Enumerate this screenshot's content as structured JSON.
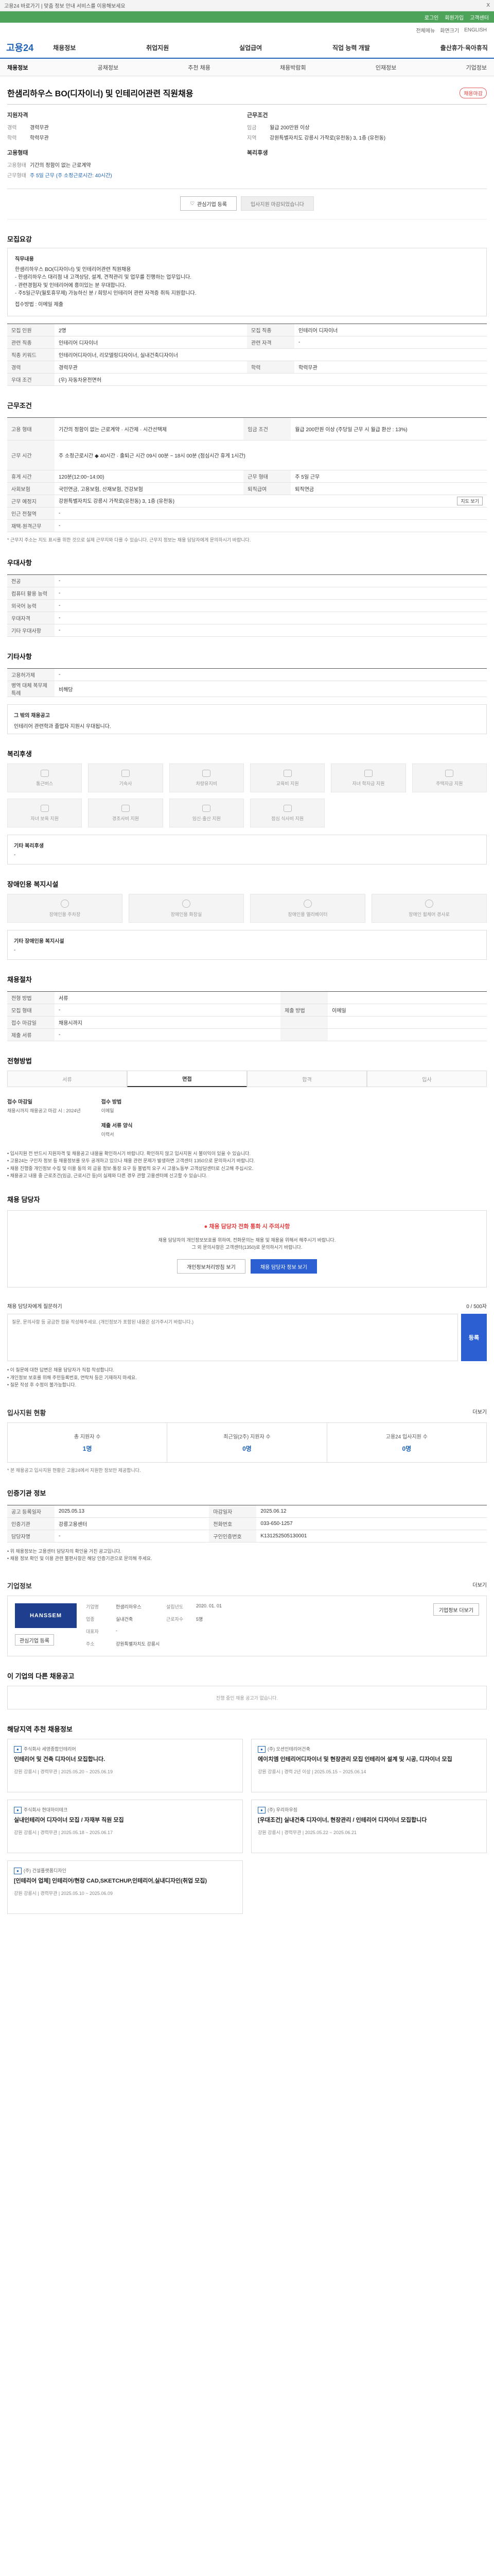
{
  "topbar": {
    "left": "고용24 바로가기 | 맞춤 정보 안내 서비스를 이용해보세요",
    "right": "X"
  },
  "greenbar": {
    "items": [
      "로그인",
      "회원가입",
      "고객센터"
    ]
  },
  "logo_row": {
    "items": [
      "전체메뉴",
      "화면크기",
      "ENGLISH"
    ]
  },
  "gnb": {
    "logo": "고용24",
    "menu": [
      "채용정보",
      "취업지원",
      "실업급여",
      "직업 능력 개발",
      "출산휴가·육아휴직"
    ]
  },
  "subnav": [
    "채용정보",
    "공채정보",
    "추천 채용",
    "채용박람회",
    "인재정보",
    "기업정보"
  ],
  "job": {
    "title": "한샘리하우스 BO(디자이너) 및 인테리어관련 직원채용",
    "status_badge": "채용마감",
    "summary_left_title": "지원자격",
    "summary_left": [
      {
        "k": "경력",
        "v": "경력무관"
      },
      {
        "k": "학력",
        "v": "학력무관"
      }
    ],
    "summary_left2_title": "고용형태",
    "summary_left2": [
      {
        "k": "고용형태",
        "v": "기간의 정함이 없는 근로계약"
      },
      {
        "k": "근무형태",
        "v": "주 5일 근무 (주 소정근로시간: 40시간)"
      }
    ],
    "summary_right_title": "근무조건",
    "summary_right": [
      {
        "k": "임금",
        "v": "월급 200만원 이상"
      },
      {
        "k": "지역",
        "v": "강원특별자치도 강릉시 가작로(유천동) 3, 1층 (유천동)"
      }
    ],
    "summary_right2_title": "복리후생",
    "buttons": {
      "interest": "관심기업 등록",
      "apply": "입사지원 마감되었습니다"
    }
  },
  "recruit_section": {
    "title": "모집요강",
    "description": [
      "직무내용",
      "한샘리하우스 BO(디자이너) 및 인테리어관련 직원채용",
      "- 한샘리하우스 대리점 내 고객상담, 설계, 견적관리 및 업무를 진행하는 업무입니다.",
      "- 관련경험자 및 인테리어에 흥미있는 분 우대합니다.",
      "- 주5일근무(월토휴무제) 가능하신 분 / 희망시 인테리어 관련 자격증 취득 지원합니다.",
      "접수방법 : 이메일 제출"
    ],
    "rows": [
      [
        {
          "th": "모집 인원",
          "td": "2명"
        },
        {
          "th": "모집 직종",
          "td": "인테리어 디자이너"
        }
      ],
      [
        {
          "th": "관련 직종",
          "td": "인테리어 디자이너"
        },
        {
          "th": "관련 자격",
          "td": "-"
        }
      ],
      [
        {
          "th": "직종 키워드",
          "td": "인테리어디자이너, 리모델링디자이너, 실내건축디자이너"
        },
        {
          "th": "",
          "td": ""
        }
      ],
      [
        {
          "th": "경력",
          "td": "경력무관"
        },
        {
          "th": "학력",
          "td": "학력무관"
        }
      ],
      [
        {
          "th": "우대 조건",
          "td": "(우) 자동차운전면허"
        },
        {
          "th": "",
          "td": ""
        }
      ]
    ]
  },
  "conditions_section": {
    "title": "근무조건",
    "rows": [
      {
        "th": "고용 형태",
        "td": "기간의 정함이 없는 근로계약 · 시간제 · 시간선택제",
        "th2": "임금 조건",
        "td2": "월급 200만원 이상 (주당일 근무 시 월급 환산 : 13%)"
      },
      {
        "th": "근무 시간",
        "td": "주 소정근로시간 ◆ 40시간 · 출퇴근 시간 09시 00분 ~ 18시 00분 (점심시간 휴게 1시간)",
        "th2": "",
        "td2": ""
      },
      {
        "th": "휴게 시간",
        "td": "120분(12:00~14:00)",
        "th2": "근무 형태",
        "td2": "주 5일 근무"
      },
      {
        "th": "사회보험",
        "td": "국민연금, 고용보험, 산재보험, 건강보험",
        "th2": "퇴직급여",
        "td2": "퇴직연금"
      },
      {
        "th": "근무 예정지",
        "td": "강원특별자치도 강릉시 가작로(유천동) 3, 1층 (유천동)",
        "th2": "",
        "td2": ""
      },
      {
        "th": "인근 전철역",
        "td": "-",
        "th2": "",
        "td2": ""
      },
      {
        "th": "재택·원격근무",
        "td": "-",
        "th2": "",
        "td2": ""
      }
    ],
    "map_button": "지도 보기",
    "note": "* 근무지 주소는 지도 표시를 위한 것으로 실제 근무지와 다를 수 있습니다. 근무지 정보는 채용 담당자에게 문의하시기 바랍니다."
  },
  "preference_section": {
    "title": "우대사항",
    "rows": [
      {
        "th": "전공",
        "td": "-"
      },
      {
        "th": "컴퓨터 활용 능력",
        "td": "-"
      },
      {
        "th": "외국어 능력",
        "td": "-"
      },
      {
        "th": "우대자격",
        "td": "-"
      },
      {
        "th": "기타 우대사항",
        "td": "-"
      }
    ]
  },
  "etc_section": {
    "title": "기타사항",
    "rows": [
      {
        "th": "고용허가제",
        "td": "-"
      },
      {
        "th": "병역 대체 복무제 특례",
        "td": "비해당"
      }
    ],
    "extra_title": "그 밖의 채용공고",
    "extra_text": "인테리어 관련학과 졸업자 지원시 우대됩니다."
  },
  "benefit_section": {
    "title": "복리후생",
    "cards": [
      "통근버스",
      "기숙사",
      "차량유지비",
      "교육비 지원",
      "자녀 학자금 지원",
      "주택자금 지원",
      "자녀 보육 지원",
      "경조사비 지원",
      "임신·출산 지원",
      "점심 식사비 지원"
    ],
    "extra_title": "기타 복리후생",
    "extra_text": "-"
  },
  "welfare_section": {
    "title": "장애인용 복지시설",
    "cards": [
      "장애인용 주차장",
      "장애인용 화장실",
      "장애인용 엘리베이터",
      "장애인 휠체어 경사로"
    ],
    "extra_title": "기타 장애인용 복지시설",
    "extra_text": "-"
  },
  "process_section": {
    "title": "채용절차",
    "rows": [
      {
        "th": "전형 방법",
        "td": "서류",
        "th2": "",
        "td2": ""
      },
      {
        "th": "모집 형태",
        "td": "-",
        "th2": "제출 방법",
        "td2": "이메일"
      },
      {
        "th": "접수 마감일",
        "td": "채용시까지",
        "th2": "",
        "td2": ""
      },
      {
        "th": "제출 서류",
        "td": "-",
        "th2": "",
        "td2": ""
      }
    ]
  },
  "hiring_section": {
    "title": "전형방법",
    "tabs": [
      "서류",
      "면접",
      "합격",
      "입사"
    ],
    "active_tab": 1,
    "blocks": [
      {
        "h": "접수 마감일",
        "p": "채용시까지 채용공고 마감 시 : 2024년"
      },
      {
        "h": "접수 방법",
        "p": "이메일"
      },
      {
        "h": "제출 서류 양식",
        "p": "이력서"
      }
    ],
    "notes": [
      "• 입사지원 전 반드시 지원자격 및 채용공고 내용을 확인하시기 바랍니다. 확인하지 않고 입사지원 시 불이익이 있을 수 있습니다.",
      "• 고용24는 구인자 정보 등 채용정보를 모두 공개하고 있으나 채용 관련 문제가 발생하면 고객센터 1350으로 문의하시기 바랍니다.",
      "• 채용 진행중 개인정보 수집 및 이용 동의 외 금융 정보·통장 요구 등 불법적 요구 시 고용노동부 고객상담센터로 신고해 주십시오.",
      "• 채용공고 내용 중 근로조건(임금, 근로시간 등)이 실제와 다른 경우 관할 고용센터에 신고할 수 있습니다."
    ]
  },
  "contact_section": {
    "title": "채용 담당자",
    "warning": "채용 담당자 전화 통화 시 주의사항",
    "lines": [
      "채용 담당자의 개인정보보호를 위하여, 전화문의는 채용 및 채용을 위해서 해주시기 바랍니다.",
      "그 외 문의사항은 고객센터(1350)로 문의하시기 바랍니다."
    ],
    "btn_view": "채용 담당자 정보 보기",
    "btn_save": "개인정보처리방침 보기"
  },
  "qa_section": {
    "title": "채용 담당자에게 질문하기",
    "counter": "0 / 500자",
    "placeholder": "질문, 문의사항 등 궁금한 점을 작성해주세요. (개인정보가 포함된 내용은 삼가주시기 바랍니다.)",
    "submit": "등록",
    "notes": [
      "• 이 질문에 대한 답변은 채용 담당자가 직접 작성합니다.",
      "• 개인정보 보호를 위해 주민등록번호, 연락처 등은 기재하지 마세요.",
      "• 질문 작성 후 수정이 불가능합니다."
    ]
  },
  "apply_status": {
    "title": "입사지원 현황",
    "link": "더보기",
    "stats": [
      {
        "label": "총 지원자 수",
        "value": "1명"
      },
      {
        "label": "최근일(2주) 지원자 수",
        "value": "0명"
      },
      {
        "label": "고용24 입사지원 수",
        "value": "0명"
      }
    ],
    "note": "* 본 채용공고 입사지원 현황은 고용24에서 지원한 정보만 제공합니다."
  },
  "register_info": {
    "title": "인증기관 정보",
    "rows": [
      {
        "th": "공고 등록일자",
        "td": "2025.05.13",
        "th2": "마감일자",
        "td2": "2025.06.12"
      },
      {
        "th": "인증기관",
        "td": "강릉고용센터",
        "th2": "전화번호",
        "td2": "033-650-1257"
      },
      {
        "th": "담당자명",
        "td": "-",
        "th2": "구인인증번호",
        "td2": "K131252505130001"
      }
    ],
    "notes": [
      "• 위 채용정보는 고용센터 담당자의 확인을 거친 공고입니다.",
      "• 채용 정보 확인 및 이용 관련 불편사항은 해당 인증기관으로 문의해 주세요."
    ]
  },
  "company_section": {
    "title": "기업정보",
    "link": "더보기",
    "logo_text": "HANSSEM",
    "info": [
      {
        "l": "기업명",
        "v": "한샘리하우스",
        "l2": "설립년도",
        "v2": "2020. 01. 01"
      },
      {
        "l": "업종",
        "v": "실내건축",
        "l2": "근로자수",
        "v2": "5명"
      },
      {
        "l": "대표자",
        "v": "-",
        "l2": "",
        "v2": ""
      },
      {
        "l": "주소",
        "v": "강원특별자치도 강릉시",
        "l2": "",
        "v2": ""
      }
    ],
    "btn_interest": "관심기업 등록",
    "btn_more": "기업정보 더보기"
  },
  "other_jobs": {
    "title": "이 기업의 다른 채용공고",
    "empty": "진행 중인 채용 공고가 없습니다."
  },
  "recommend": {
    "title": "해당지역 추천 채용정보",
    "items": [
      {
        "company": "주식회사 세영종합인테리어",
        "title": "인테리어 및 건축 디자이너 모집합니다.",
        "meta": "강원 강릉시 | 경력무관 | 2025.05.20 ~ 2025.06.19"
      },
      {
        "company": "(주) 오션인테리어건축",
        "title": "에이치엠 인테리어디자이너 및 현장관리 모집 인테리어 설계 및 시공, 디자이너 모집",
        "meta": "강원 강릉시 | 경력 2년 이상 | 2025.05.15 ~ 2025.06.14"
      },
      {
        "company": "주식회사 현대하이테크",
        "title": "실내인테리어 디자이너 모집 / 자재부 직원 모집",
        "meta": "강원 강릉시 | 경력무관 | 2025.05.18 ~ 2025.06.17"
      },
      {
        "company": "(주) 우리하우징",
        "title": "[우대조건] 실내건축 디자이너, 현장관리 / 인테리어 디자이너 모집합니다",
        "meta": "강원 강릉시 | 경력무관 | 2025.05.22 ~ 2025.06.21"
      },
      {
        "company": "(주) 건설플랫폼디자인",
        "title": "[인테리어 업체] 인테리어/현장 CAD,SKETCHUP,인테리어,실내디자인(취업 모집)",
        "meta": "강원 강릉시 | 경력무관 | 2025.05.10 ~ 2025.06.09"
      }
    ]
  }
}
